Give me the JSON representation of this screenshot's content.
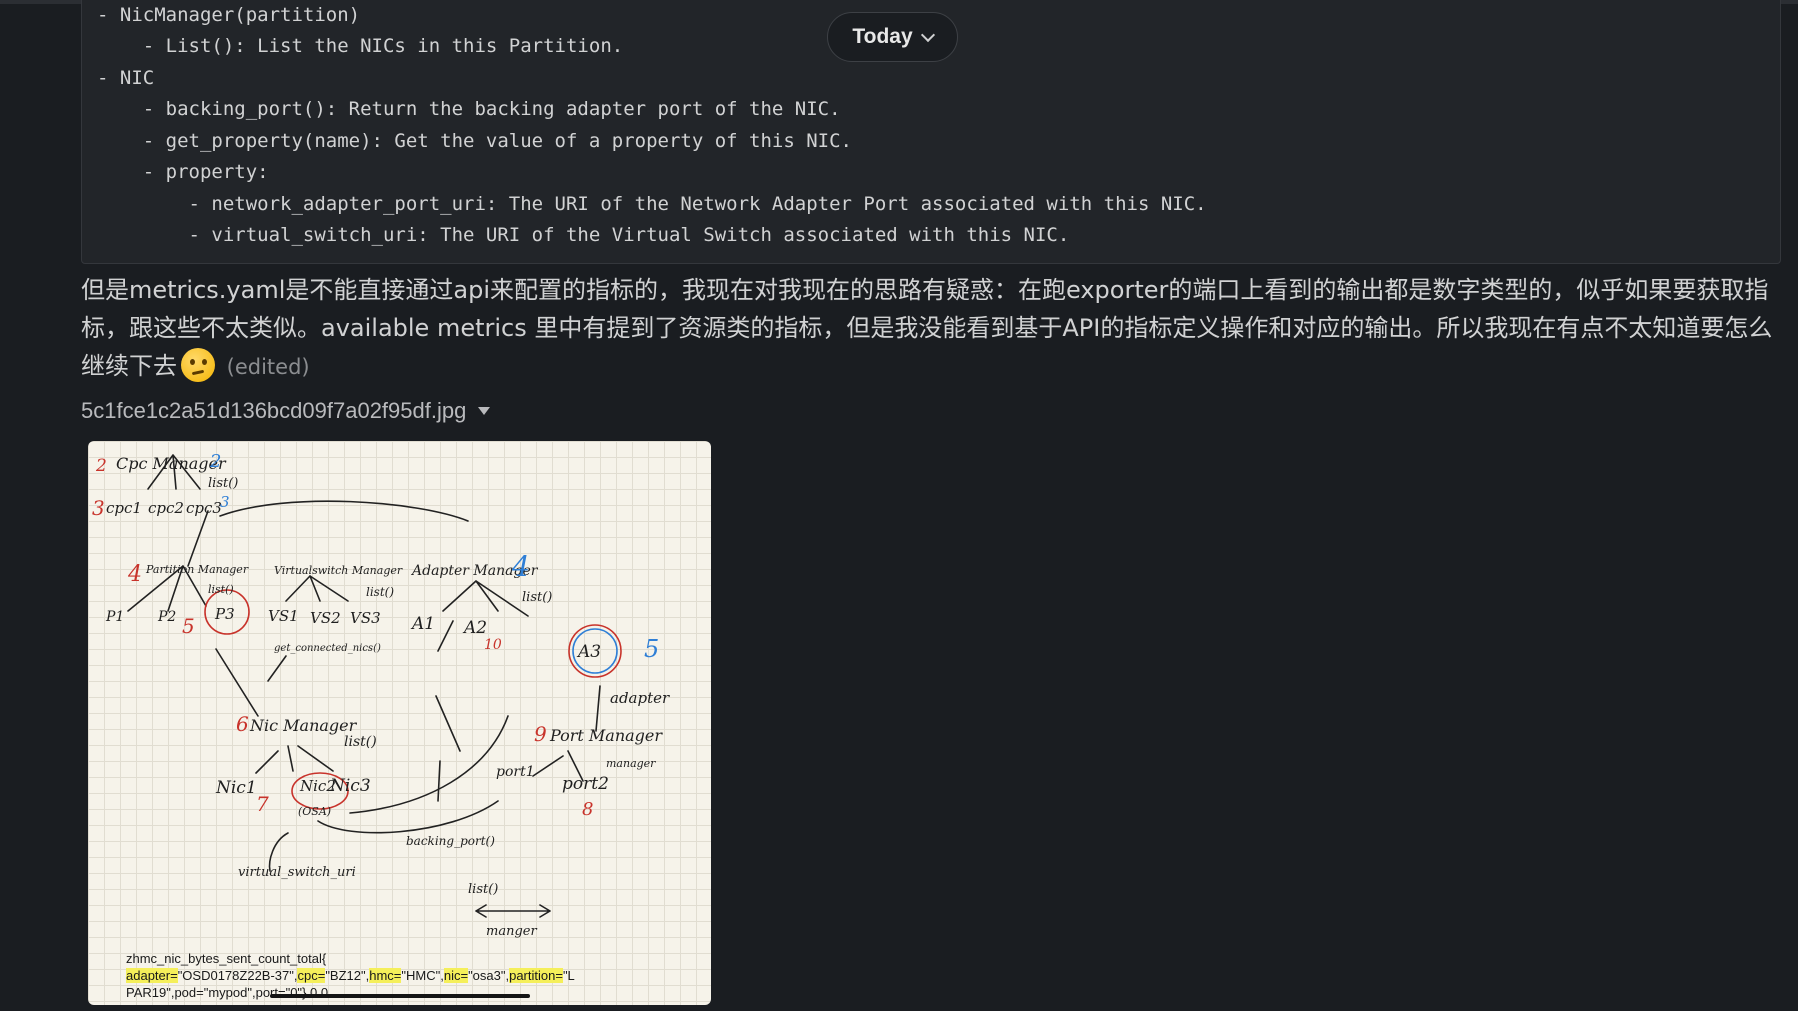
{
  "code_block": {
    "lines": [
      "- NicManager(partition)",
      "    - List(): List the NICs in this Partition.",
      "- NIC",
      "    - backing_port(): Return the backing adapter port of the NIC.",
      "    - get_property(name): Get the value of a property of this NIC.",
      "    - property:",
      "        - network_adapter_port_uri: The URI of the Network Adapter Port associated with this NIC.",
      "        - virtual_switch_uri: The URI of the Virtual Switch associated with this NIC."
    ]
  },
  "date_divider": {
    "label": "Today"
  },
  "message": {
    "text": "但是metrics.yaml是不能直接通过api来配置的指标的，我现在对我现在的思路有疑惑：在跑exporter的端口上看到的输出都是数字类型的，似乎如果要获取指标，跟这些不太类似。available metrics 里中有提到了资源类的指标，但是我没能看到基于API的指标定义操作和对应的输出。所以我现在有点不太知道要怎么继续下去",
    "emoji": "thinking-face",
    "edited_label": "(edited)"
  },
  "attachment": {
    "filename": "5c1fce1c2a51d136bcd09f7a02f95df.jpg",
    "sketch": {
      "labels": [
        "Cpc Manager",
        "list()",
        "cpc1",
        "cpc2",
        "cpc3",
        "Partition Manager",
        "list()",
        "P1",
        "P2",
        "P3",
        "Virtualswitch Manager",
        "list()",
        "VS1",
        "VS2",
        "VS3",
        "get_connected_nics()",
        "Adapter Manager",
        "list()",
        "A1",
        "A2",
        "A3",
        "adapter",
        "Nic Manager",
        "list()",
        "Nic1",
        "Nic2",
        "(OSA)",
        "Nic3",
        "Port Manager",
        "port1",
        "port2",
        "manager",
        "backing_port()",
        "virtual_switch_uri",
        "list()",
        "manger"
      ],
      "numbers_red": [
        "2",
        "3",
        "4",
        "5",
        "6",
        "7",
        "8",
        "9",
        "10"
      ],
      "numbers_blue": [
        "2",
        "3",
        "4",
        "5"
      ]
    },
    "metric_text": {
      "line1": "zhmc_nic_bytes_sent_count_total{",
      "adapter_key": "adapter=",
      "adapter_val": "\"OSD0178Z22B-37\",",
      "cpc_key": "cpc=",
      "cpc_val": "\"BZ12\",",
      "hmc_key": "hmc=",
      "hmc_val": "\"HMC\",",
      "nic_key": "nic=",
      "nic_val": "\"osa3\",",
      "partition_key": "partition=",
      "partition_val": "\"L",
      "line3": "PAR19\",pod=\"mypod\",port=\"0\"} 0.0"
    }
  }
}
